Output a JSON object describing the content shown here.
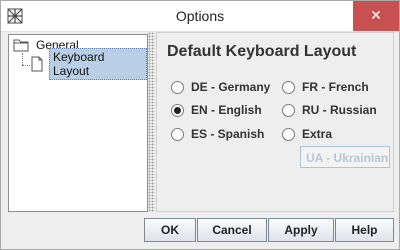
{
  "window": {
    "title": "Options",
    "close_symbol": "✕"
  },
  "tree": {
    "items": [
      {
        "label": "General",
        "icon": "folder-icon"
      },
      {
        "label": "Keyboard Layout",
        "icon": "document-icon",
        "selected": true
      }
    ]
  },
  "panel": {
    "title": "Default Keyboard Layout",
    "options": [
      {
        "label": "DE - Germany",
        "checked": false
      },
      {
        "label": "EN - English",
        "checked": true
      },
      {
        "label": "ES - Spanish",
        "checked": false
      },
      {
        "label": "FR - French",
        "checked": false
      },
      {
        "label": "RU - Russian",
        "checked": false
      },
      {
        "label": "Extra",
        "checked": false
      }
    ],
    "extra_value": "UA - Ukrainian"
  },
  "buttons": {
    "ok": "OK",
    "cancel": "Cancel",
    "apply": "Apply",
    "help": "Help"
  }
}
